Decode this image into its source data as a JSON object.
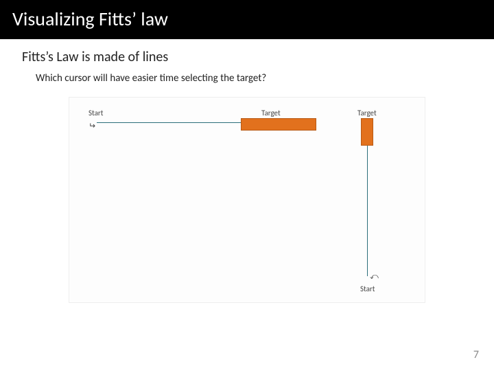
{
  "title": "Visualizing Fitts’ law",
  "subtitle": "Fitts’s Law is made of lines",
  "question": "Which cursor will have easier time selecting the target?",
  "diagram": {
    "start_left_label": "Start",
    "target_mid_label": "Target",
    "target_right_label": "Target",
    "start_bottom_label": "Start"
  },
  "page_number": "7"
}
